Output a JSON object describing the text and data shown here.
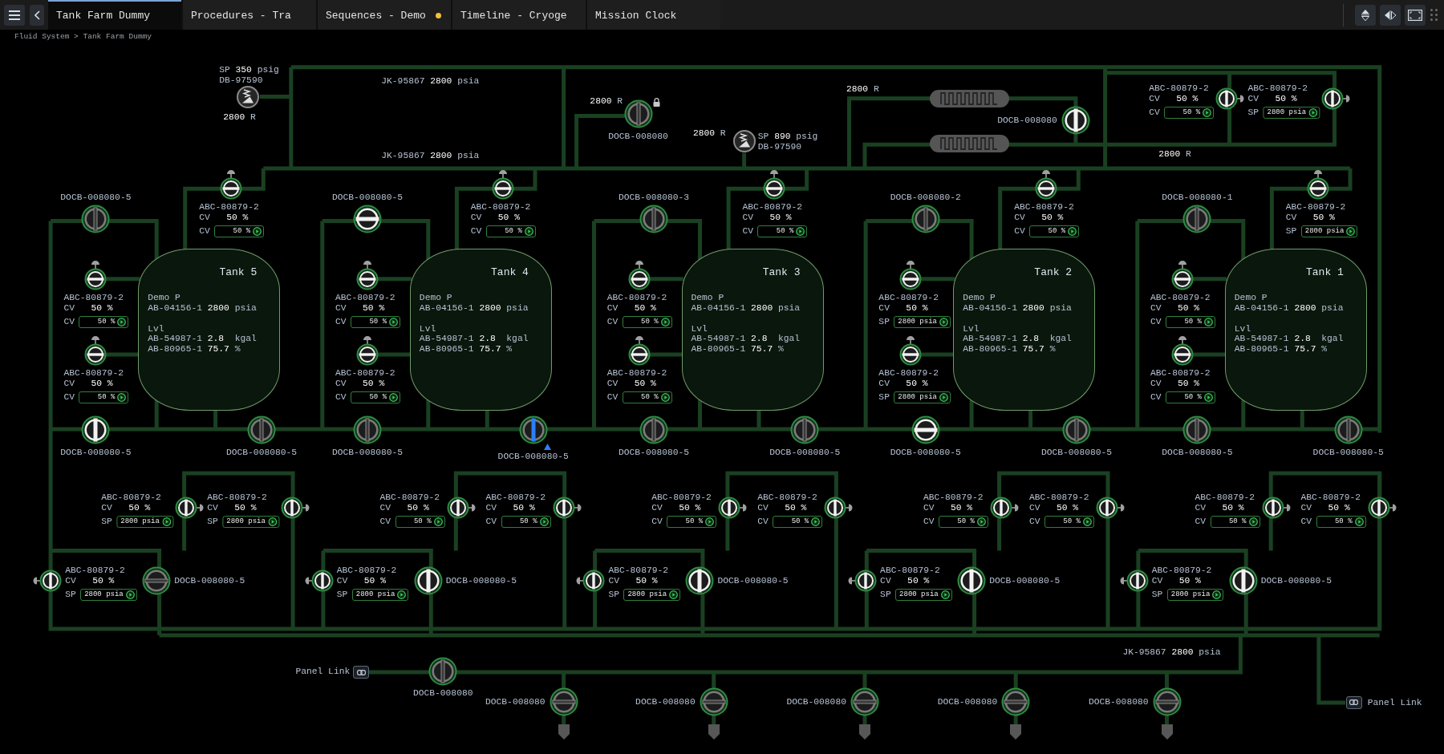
{
  "tabs": [
    {
      "label": "Tank Farm Dummy",
      "selected": true,
      "modified": false
    },
    {
      "label": "Procedures - Tra",
      "selected": false,
      "modified": false
    },
    {
      "label": "Sequences - Demo",
      "selected": false,
      "modified": true
    },
    {
      "label": "Timeline - Cryoge",
      "selected": false,
      "modified": false
    },
    {
      "label": "Mission Clock",
      "selected": false,
      "modified": false
    }
  ],
  "breadcrumb": "Fluid System > Tank Farm Dummy",
  "supply": {
    "regulators": [
      {
        "setpoint": "SP **350** psig",
        "tag": "DB-97590",
        "reading": "**2800** R"
      },
      {
        "setpoint": "SP **890** psig",
        "tag": "DB-97590",
        "reading": "**2800** R"
      }
    ],
    "readouts": [
      "JK-95867 **2800** psia",
      "JK-95867 **2800** psia"
    ],
    "isolation_valve": {
      "tag": "DOCB-008080",
      "reading": "**2800** R",
      "open": false,
      "energized": false,
      "selected": false,
      "locked": true
    },
    "heater_reading": "**2800** R",
    "heater_valve": {
      "tag": "DOCB-008080",
      "open": true,
      "energized": true,
      "selected": false
    },
    "vent_valves": [
      {
        "tag": "ABC-80879-2",
        "mode": "CV",
        "reading": "50 %",
        "input_label": "CV",
        "input_value": "50 %",
        "open": true,
        "energized": true
      },
      {
        "tag": "ABC-80879-2",
        "mode": "CV",
        "reading": "50 %",
        "input_label": "SP",
        "input_value": "2800 psia",
        "open": true,
        "energized": true
      }
    ],
    "vent_reading": "**2800** R"
  },
  "tanks": [
    {
      "name": "Tank 5",
      "pressure_title": "Demo P",
      "pressure": "AB-04156-1 **2800** psia",
      "volume_title": "Lvl",
      "volume": "AB-54987-1 **2.8**  kgal",
      "fill": "AB-80965-1 **75.7** %",
      "inlet_valve": {
        "tag": "DOCB-008080-5",
        "open": false,
        "energized": false,
        "selected": false
      },
      "top_valve": {
        "tag": "ABC-80879-2",
        "mode": "CV",
        "reading": "50 %",
        "input_label": "CV",
        "input_value": "50 %",
        "open": true,
        "energized": true
      },
      "side_valves": [
        {
          "tag": "ABC-80879-2",
          "mode": "CV",
          "reading": "50 %",
          "input_label": "CV",
          "input_value": "50 %",
          "open": true,
          "energized": true
        },
        {
          "tag": "ABC-80879-2",
          "mode": "CV",
          "reading": "50 %",
          "input_label": "CV",
          "input_value": "50 %",
          "open": true,
          "energized": true
        }
      ],
      "drain_valves": [
        {
          "tag": "DOCB-008080-5",
          "open": false,
          "energized": true,
          "selected": false
        },
        {
          "tag": "DOCB-008080-5",
          "open": false,
          "energized": false,
          "selected": false
        }
      ]
    },
    {
      "name": "Tank 4",
      "pressure_title": "Demo P",
      "pressure": "AB-04156-1 **2800** psia",
      "volume_title": "Lvl",
      "volume": "AB-54987-1 **2.8**  kgal",
      "fill": "AB-80965-1 **75.7** %",
      "inlet_valve": {
        "tag": "DOCB-008080-5",
        "open": true,
        "energized": true,
        "selected": false
      },
      "top_valve": {
        "tag": "ABC-80879-2",
        "mode": "CV",
        "reading": "50 %",
        "input_label": "CV",
        "input_value": "50 %",
        "open": true,
        "energized": true
      },
      "side_valves": [
        {
          "tag": "ABC-80879-2",
          "mode": "CV",
          "reading": "50 %",
          "input_label": "CV",
          "input_value": "50 %",
          "open": true,
          "energized": true
        },
        {
          "tag": "ABC-80879-2",
          "mode": "CV",
          "reading": "50 %",
          "input_label": "CV",
          "input_value": "50 %",
          "open": true,
          "energized": true
        }
      ],
      "drain_valves": [
        {
          "tag": "DOCB-008080-5",
          "open": false,
          "energized": false,
          "selected": false
        },
        {
          "tag": "DOCB-008080-5",
          "open": false,
          "energized": false,
          "selected": true
        }
      ]
    },
    {
      "name": "Tank 3",
      "pressure_title": "Demo P",
      "pressure": "AB-04156-1 **2800** psia",
      "volume_title": "Lvl",
      "volume": "AB-54987-1 **2.8**  kgal",
      "fill": "AB-80965-1 **75.7** %",
      "inlet_valve": {
        "tag": "DOCB-008080-3",
        "open": false,
        "energized": false,
        "selected": false
      },
      "top_valve": {
        "tag": "ABC-80879-2",
        "mode": "CV",
        "reading": "50 %",
        "input_label": "CV",
        "input_value": "50 %",
        "open": true,
        "energized": true
      },
      "side_valves": [
        {
          "tag": "ABC-80879-2",
          "mode": "CV",
          "reading": "50 %",
          "input_label": "CV",
          "input_value": "50 %",
          "open": true,
          "energized": true
        },
        {
          "tag": "ABC-80879-2",
          "mode": "CV",
          "reading": "50 %",
          "input_label": "CV",
          "input_value": "50 %",
          "open": true,
          "energized": true
        }
      ],
      "drain_valves": [
        {
          "tag": "DOCB-008080-5",
          "open": false,
          "energized": false,
          "selected": false
        },
        {
          "tag": "DOCB-008080-5",
          "open": false,
          "energized": false,
          "selected": false
        }
      ]
    },
    {
      "name": "Tank 2",
      "pressure_title": "Demo P",
      "pressure": "AB-04156-1 **2800** psia",
      "volume_title": "Lvl",
      "volume": "AB-54987-1 **2.8**  kgal",
      "fill": "AB-80965-1 **75.7** %",
      "inlet_valve": {
        "tag": "DOCB-008080-2",
        "open": false,
        "energized": false,
        "selected": false
      },
      "top_valve": {
        "tag": "ABC-80879-2",
        "mode": "CV",
        "reading": "50 %",
        "input_label": "CV",
        "input_value": "50 %",
        "open": true,
        "energized": true
      },
      "side_valves": [
        {
          "tag": "ABC-80879-2",
          "mode": "CV",
          "reading": "50 %",
          "input_label": "SP",
          "input_value": "2800 psia",
          "open": true,
          "energized": true
        },
        {
          "tag": "ABC-80879-2",
          "mode": "CV",
          "reading": "50 %",
          "input_label": "SP",
          "input_value": "2800 psia",
          "open": true,
          "energized": true
        }
      ],
      "drain_valves": [
        {
          "tag": "DOCB-008080-5",
          "open": true,
          "energized": true,
          "selected": false
        },
        {
          "tag": "DOCB-008080-5",
          "open": false,
          "energized": false,
          "selected": false
        }
      ]
    },
    {
      "name": "Tank 1",
      "pressure_title": "Demo P",
      "pressure": "AB-04156-1 **2800** psia",
      "volume_title": "Lvl",
      "volume": "AB-54987-1 **2.8**  kgal",
      "fill": "AB-80965-1 **75.7** %",
      "inlet_valve": {
        "tag": "DOCB-008080-1",
        "open": false,
        "energized": false,
        "selected": false
      },
      "top_valve": {
        "tag": "ABC-80879-2",
        "mode": "CV",
        "reading": "50 %",
        "input_label": "SP",
        "input_value": "2800 psia",
        "open": true,
        "energized": true
      },
      "side_valves": [
        {
          "tag": "ABC-80879-2",
          "mode": "CV",
          "reading": "50 %",
          "input_label": "CV",
          "input_value": "50 %",
          "open": true,
          "energized": true
        },
        {
          "tag": "ABC-80879-2",
          "mode": "CV",
          "reading": "50 %",
          "input_label": "CV",
          "input_value": "50 %",
          "open": true,
          "energized": true
        }
      ],
      "drain_valves": [
        {
          "tag": "DOCB-008080-5",
          "open": false,
          "energized": false,
          "selected": false
        },
        {
          "tag": "DOCB-008080-5",
          "open": false,
          "energized": false,
          "selected": false
        }
      ]
    }
  ],
  "manifolds": [
    {
      "upper_valves": [
        {
          "tag": "ABC-80879-2",
          "mode": "CV",
          "reading": "50 %",
          "input_label": "SP",
          "input_value": "2800 psia",
          "open": true,
          "energized": true
        },
        {
          "tag": "ABC-80879-2",
          "mode": "CV",
          "reading": "50 %",
          "input_label": "SP",
          "input_value": "2800 psia",
          "open": true,
          "energized": true
        }
      ],
      "lower_valve": {
        "tag": "ABC-80879-2",
        "mode": "CV",
        "reading": "50 %",
        "input_label": "SP",
        "input_value": "2800 psia",
        "open": true,
        "energized": true
      },
      "isolation_valve": {
        "tag": "DOCB-008080-5",
        "open": false,
        "energized": false,
        "selected": false
      }
    },
    {
      "upper_valves": [
        {
          "tag": "ABC-80879-2",
          "mode": "CV",
          "reading": "50 %",
          "input_label": "CV",
          "input_value": "50 %",
          "open": true,
          "energized": true
        },
        {
          "tag": "ABC-80879-2",
          "mode": "CV",
          "reading": "50 %",
          "input_label": "CV",
          "input_value": "50 %",
          "open": true,
          "energized": true
        }
      ],
      "lower_valve": {
        "tag": "ABC-80879-2",
        "mode": "CV",
        "reading": "50 %",
        "input_label": "SP",
        "input_value": "2800 psia",
        "open": true,
        "energized": true
      },
      "isolation_valve": {
        "tag": "DOCB-008080-5",
        "open": true,
        "energized": true,
        "selected": false
      }
    },
    {
      "upper_valves": [
        {
          "tag": "ABC-80879-2",
          "mode": "CV",
          "reading": "50 %",
          "input_label": "CV",
          "input_value": "50 %",
          "open": true,
          "energized": true
        },
        {
          "tag": "ABC-80879-2",
          "mode": "CV",
          "reading": "50 %",
          "input_label": "CV",
          "input_value": "50 %",
          "open": true,
          "energized": true
        }
      ],
      "lower_valve": {
        "tag": "ABC-80879-2",
        "mode": "CV",
        "reading": "50 %",
        "input_label": "SP",
        "input_value": "2800 psia",
        "open": true,
        "energized": true
      },
      "isolation_valve": {
        "tag": "DOCB-008080-5",
        "open": true,
        "energized": true,
        "selected": false
      }
    },
    {
      "upper_valves": [
        {
          "tag": "ABC-80879-2",
          "mode": "CV",
          "reading": "50 %",
          "input_label": "CV",
          "input_value": "50 %",
          "open": true,
          "energized": true
        },
        {
          "tag": "ABC-80879-2",
          "mode": "CV",
          "reading": "50 %",
          "input_label": "CV",
          "input_value": "50 %",
          "open": true,
          "energized": true
        }
      ],
      "lower_valve": {
        "tag": "ABC-80879-2",
        "mode": "CV",
        "reading": "50 %",
        "input_label": "SP",
        "input_value": "2800 psia",
        "open": true,
        "energized": true
      },
      "isolation_valve": {
        "tag": "DOCB-008080-5",
        "open": true,
        "energized": true,
        "selected": false
      }
    },
    {
      "upper_valves": [
        {
          "tag": "ABC-80879-2",
          "mode": "CV",
          "reading": "50 %",
          "input_label": "CV",
          "input_value": "50 %",
          "open": true,
          "energized": true
        },
        {
          "tag": "ABC-80879-2",
          "mode": "CV",
          "reading": "50 %",
          "input_label": "CV",
          "input_value": "50 %",
          "open": true,
          "energized": true
        }
      ],
      "lower_valve": {
        "tag": "ABC-80879-2",
        "mode": "CV",
        "reading": "50 %",
        "input_label": "SP",
        "input_value": "2800 psia",
        "open": true,
        "energized": true
      },
      "isolation_valve": {
        "tag": "DOCB-008080-5",
        "open": true,
        "energized": true,
        "selected": false
      }
    }
  ],
  "outlet": {
    "link_label": "Panel Link",
    "valve": {
      "tag": "DOCB-008080",
      "open": false,
      "energized": false,
      "selected": false
    },
    "readout": "JK-95867 **2800** psia",
    "drains": [
      {
        "tag": "DOCB-008080",
        "open": false,
        "energized": false,
        "selected": false
      },
      {
        "tag": "DOCB-008080",
        "open": false,
        "energized": false,
        "selected": false
      },
      {
        "tag": "DOCB-008080",
        "open": false,
        "energized": false,
        "selected": false
      },
      {
        "tag": "DOCB-008080",
        "open": false,
        "energized": false,
        "selected": false
      },
      {
        "tag": "DOCB-008080",
        "open": false,
        "energized": false,
        "selected": false
      }
    ],
    "right_link_label": "Panel Link"
  }
}
